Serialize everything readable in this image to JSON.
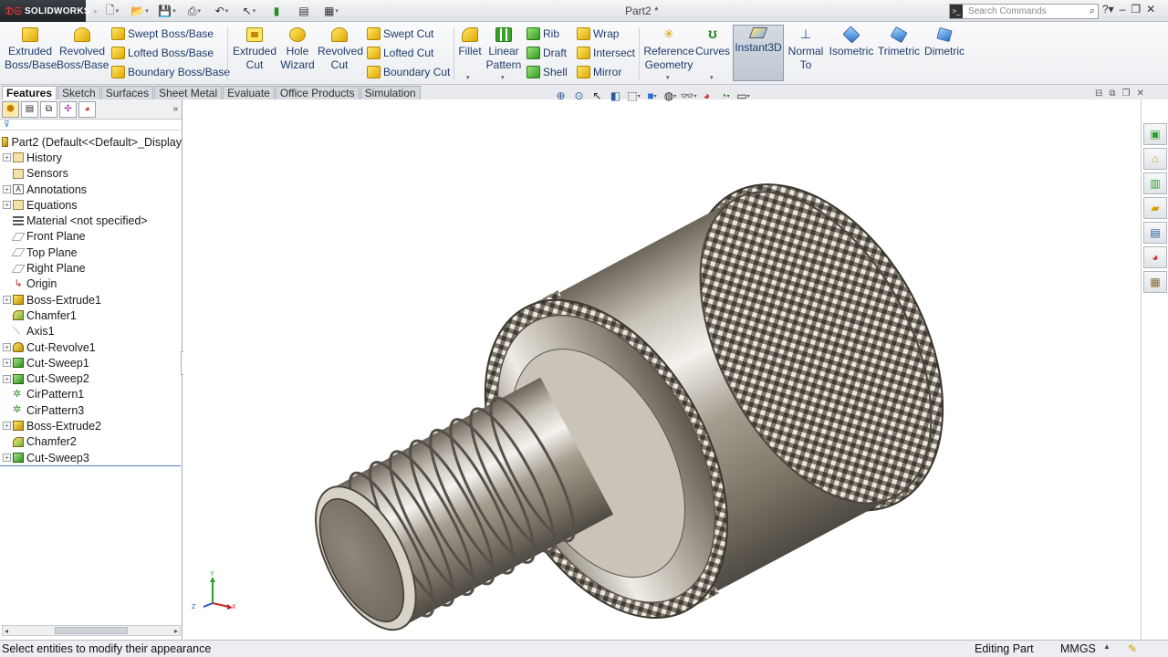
{
  "app": {
    "brand": "SOLIDWORKS",
    "document_title": "Part2 *"
  },
  "search": {
    "placeholder": "Search Commands"
  },
  "ribbon": {
    "extruded_boss": "Extruded Boss/Base",
    "revolved_boss": "Revolved Boss/Base",
    "swept_boss": "Swept Boss/Base",
    "lofted_boss": "Lofted Boss/Base",
    "boundary_boss": "Boundary Boss/Base",
    "extruded_cut": "Extruded Cut",
    "hole_wizard": "Hole Wizard",
    "revolved_cut": "Revolved Cut",
    "swept_cut": "Swept Cut",
    "lofted_cut": "Lofted Cut",
    "boundary_cut": "Boundary Cut",
    "fillet": "Fillet",
    "linear_pattern": "Linear Pattern",
    "rib": "Rib",
    "draft": "Draft",
    "shell": "Shell",
    "wrap": "Wrap",
    "intersect": "Intersect",
    "mirror": "Mirror",
    "reference_geometry": "Reference Geometry",
    "curves": "Curves",
    "instant3d": "Instant3D",
    "normal_to": "Normal To",
    "isometric": "Isometric",
    "trimetric": "Trimetric",
    "dimetric": "Dimetric"
  },
  "tabs": [
    "Features",
    "Sketch",
    "Surfaces",
    "Sheet Metal",
    "Evaluate",
    "Office Products",
    "Simulation"
  ],
  "tree": {
    "root": "Part2  (Default<<Default>_Display",
    "items": [
      "History",
      "Sensors",
      "Annotations",
      "Equations",
      "Material <not specified>",
      "Front Plane",
      "Top Plane",
      "Right Plane",
      "Origin",
      "Boss-Extrude1",
      "Chamfer1",
      "Axis1",
      "Cut-Revolve1",
      "Cut-Sweep1",
      "Cut-Sweep2",
      "CirPattern1",
      "CirPattern3",
      "Boss-Extrude2",
      "Chamfer2",
      "Cut-Sweep3"
    ]
  },
  "triad": {
    "x": "X",
    "y": "Y",
    "z": "Z"
  },
  "status": {
    "message": "Select entities to modify their appearance",
    "mode": "Editing Part",
    "units": "MMGS"
  }
}
